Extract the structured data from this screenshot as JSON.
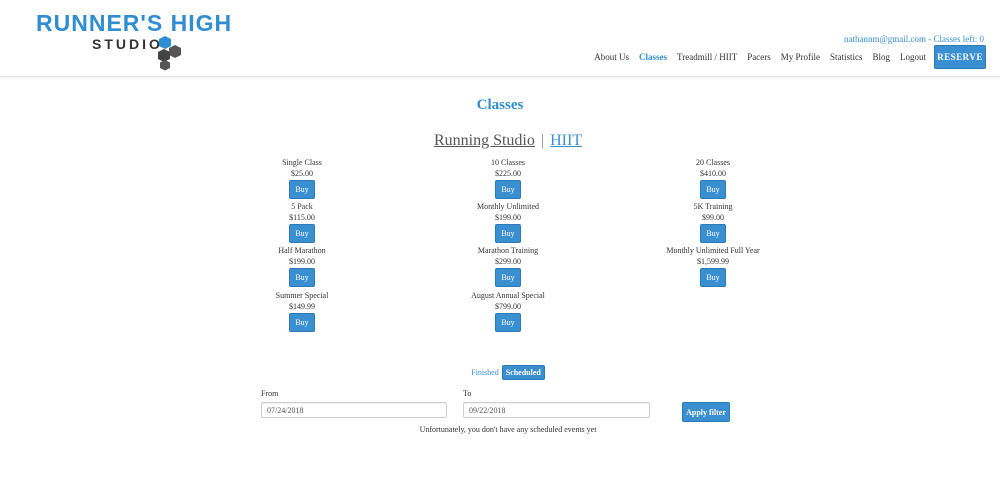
{
  "brand": {
    "title": "RUNNER'S HIGH",
    "subtitle": "STUDIO"
  },
  "account": {
    "line": "nathannm@gmail.com - Classes left: 0"
  },
  "nav": {
    "items": [
      "About Us",
      "Classes",
      "Treadmill / HIIT",
      "Pacers",
      "My Profile",
      "Statistics",
      "Blog",
      "Logout"
    ],
    "active": "Classes",
    "reserve_label": "RESERVE"
  },
  "page": {
    "title": "Classes"
  },
  "studio_tabs": {
    "tab1": "Running Studio",
    "separator": "|",
    "tab2": "HIIT"
  },
  "products": [
    {
      "name": "Single Class",
      "price": "$25.00",
      "buy": "Buy"
    },
    {
      "name": "10 Classes",
      "price": "$225.00",
      "buy": "Buy"
    },
    {
      "name": "20 Classes",
      "price": "$410.00",
      "buy": "Buy"
    },
    {
      "name": "5 Pack",
      "price": "$115.00",
      "buy": "Buy"
    },
    {
      "name": "Monthly Unlimited",
      "price": "$199.00",
      "buy": "Buy"
    },
    {
      "name": "5K Training",
      "price": "$99.00",
      "buy": "Buy"
    },
    {
      "name": "Half Marathon",
      "price": "$199.00",
      "buy": "Buy"
    },
    {
      "name": "Marathon Training",
      "price": "$299.00",
      "buy": "Buy"
    },
    {
      "name": "Monthly Unlimited Full Year",
      "price": "$1,599.99",
      "buy": "Buy"
    },
    {
      "name": "Summer Special",
      "price": "$149.99",
      "buy": "Buy"
    },
    {
      "name": "August Annual Special",
      "price": "$799.00",
      "buy": "Buy"
    }
  ],
  "events": {
    "finished_label": "Finished",
    "scheduled_label": "Scheduled",
    "from_label": "From",
    "to_label": "To",
    "from_value": "07/24/2018",
    "to_value": "09/22/2018",
    "apply_label": "Apply filter",
    "empty_message": "Unfortunately, you don't have any scheduled events yet"
  },
  "colors": {
    "accent": "#3a8fd0",
    "brand": "#2f8ed1",
    "hex_dark": "#555555"
  }
}
